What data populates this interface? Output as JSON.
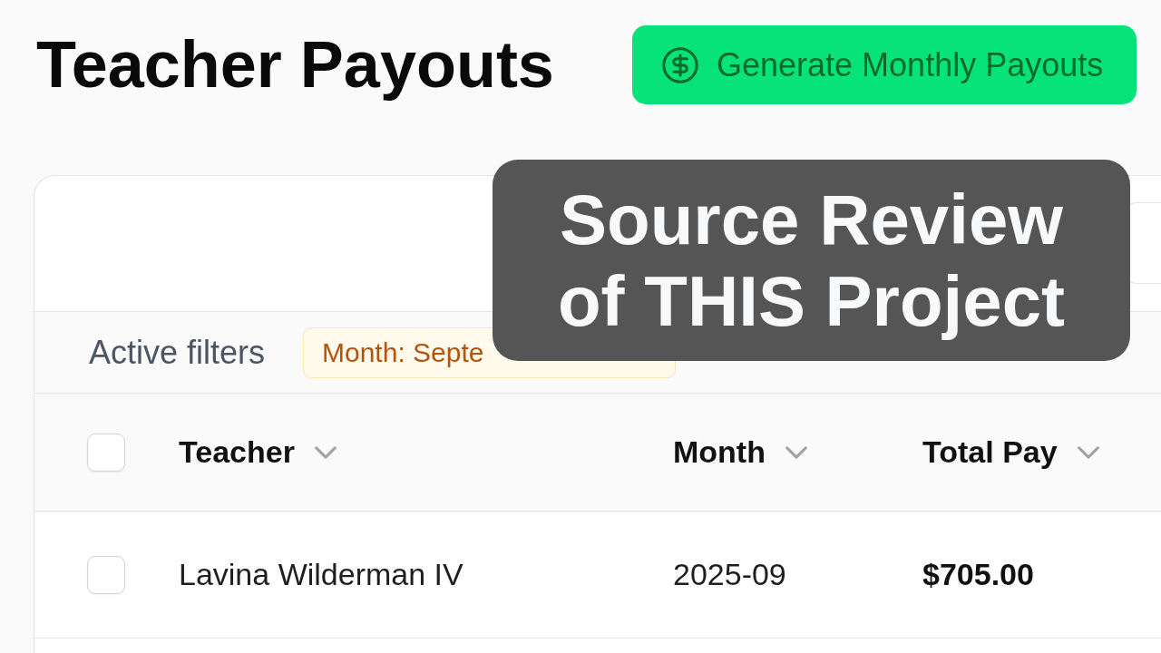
{
  "header": {
    "title": "Teacher Payouts",
    "action": {
      "label": "Generate Monthly Payouts"
    }
  },
  "filters": {
    "label": "Active filters",
    "chips": [
      {
        "label": "Month: Septe"
      }
    ]
  },
  "table": {
    "select_all": {
      "checked": false
    },
    "columns": [
      {
        "label": "Teacher",
        "kind": "text"
      },
      {
        "label": "Month",
        "kind": "text"
      },
      {
        "label": "Total Pay",
        "kind": "amount"
      }
    ],
    "rows": [
      {
        "checked": false,
        "cells": [
          "Lavina Wilderman IV",
          "2025-09",
          "$705.00"
        ]
      }
    ]
  },
  "caption": {
    "text": "Source Review of THIS Project"
  }
}
